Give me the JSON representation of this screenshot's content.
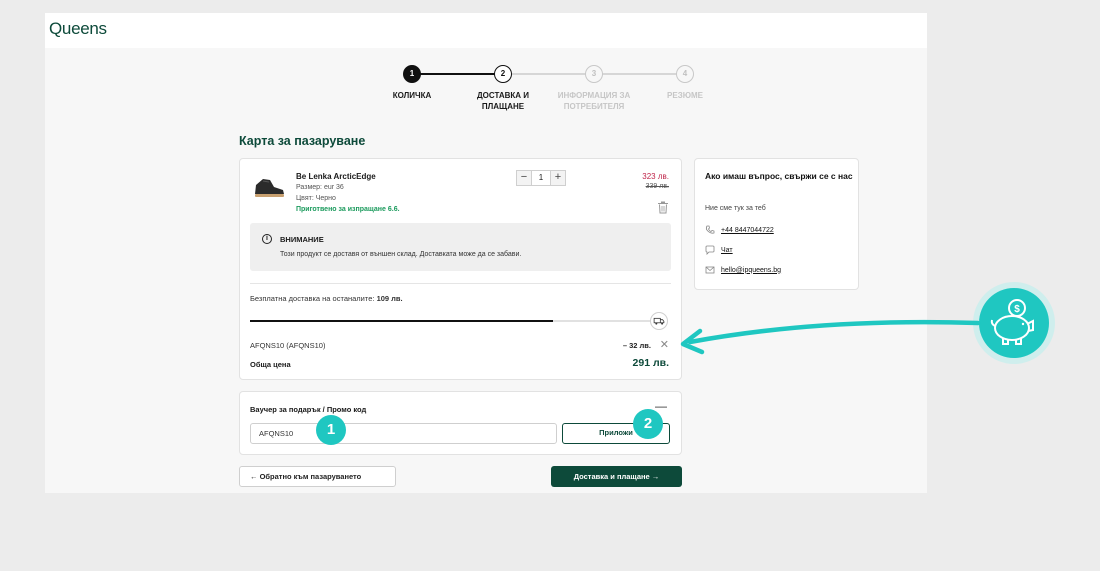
{
  "header": {
    "logo": "Queens"
  },
  "stepper": {
    "steps": [
      {
        "number": "1",
        "label": "КОЛИЧКА"
      },
      {
        "number": "2",
        "label": "ДОСТАВКА И ПЛАЩАНЕ"
      },
      {
        "number": "3",
        "label": "ИНФОРМАЦИЯ ЗА ПОТРЕБИТЕЛЯ"
      },
      {
        "number": "4",
        "label": "РЕЗЮМЕ"
      }
    ]
  },
  "cart": {
    "title": "Карта за пазаруване",
    "item": {
      "name": "Be Lenka ArcticEdge",
      "size": "Размер: eur 36",
      "color": "Цвят: Черно",
      "ready": "Приготвено за изпращане 6.6.",
      "quantity": "1",
      "qty_minus": "−",
      "qty_plus": "+",
      "price": "323 лв.",
      "old_price": "339 лв."
    },
    "notice": {
      "icon": "i",
      "title": "ВНИМАНИЕ",
      "text": "Този продукт се доставя от външен склад. Доставката може да се забави."
    },
    "free_shipping_label": "Безплатна доставка на останалите: ",
    "free_shipping_amount": "109 лв.",
    "free_shipping_progress": 0.74,
    "promo_code": "AFQNS10 (AFQNS10)",
    "discount": "– 32 лв.",
    "remove": "✕",
    "total_label": "Обща цена",
    "total_value": "291 лв."
  },
  "contact": {
    "title": "Ако имаш въпрос, свържи се с нас",
    "subtitle": "Ние сме тук за теб",
    "phone": "+44 8447044722",
    "chat": "Чат",
    "email": "hello@ipqueens.bg"
  },
  "voucher": {
    "title": "Ваучер за подарък / Промо код",
    "collapse": "—",
    "input_value": "AFQNS10",
    "apply_label": "Приложи"
  },
  "buttons": {
    "back_label": "← Обратно към пазаруването",
    "next_label": "Доставка и плащане →"
  },
  "annotations": {
    "badge_1": "1",
    "badge_2": "2"
  },
  "colors": {
    "brand": "#0d4a3a",
    "accent": "#1fc7c1",
    "price": "#c0254a",
    "ready": "#1a9a5c"
  }
}
